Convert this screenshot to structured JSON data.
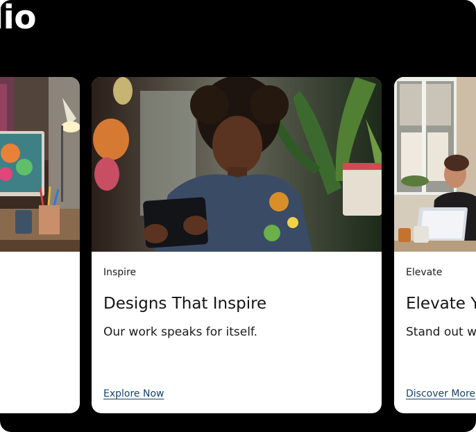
{
  "page": {
    "heading": "lio"
  },
  "cards": [
    {
      "image_alt": "Artist desk with desk lamp, monitor and pencils",
      "category": "",
      "title": "",
      "description": "",
      "cta": ""
    },
    {
      "image_alt": "Child using a tablet surrounded by plants",
      "category": "Inspire",
      "title": "Designs That Inspire",
      "description": "Our work speaks for itself.",
      "cta": "Explore Now"
    },
    {
      "image_alt": "Woman working on a laptop by a window",
      "category": "Elevate",
      "title": "Elevate Y",
      "description": "Stand out w",
      "cta": "Discover More"
    }
  ]
}
